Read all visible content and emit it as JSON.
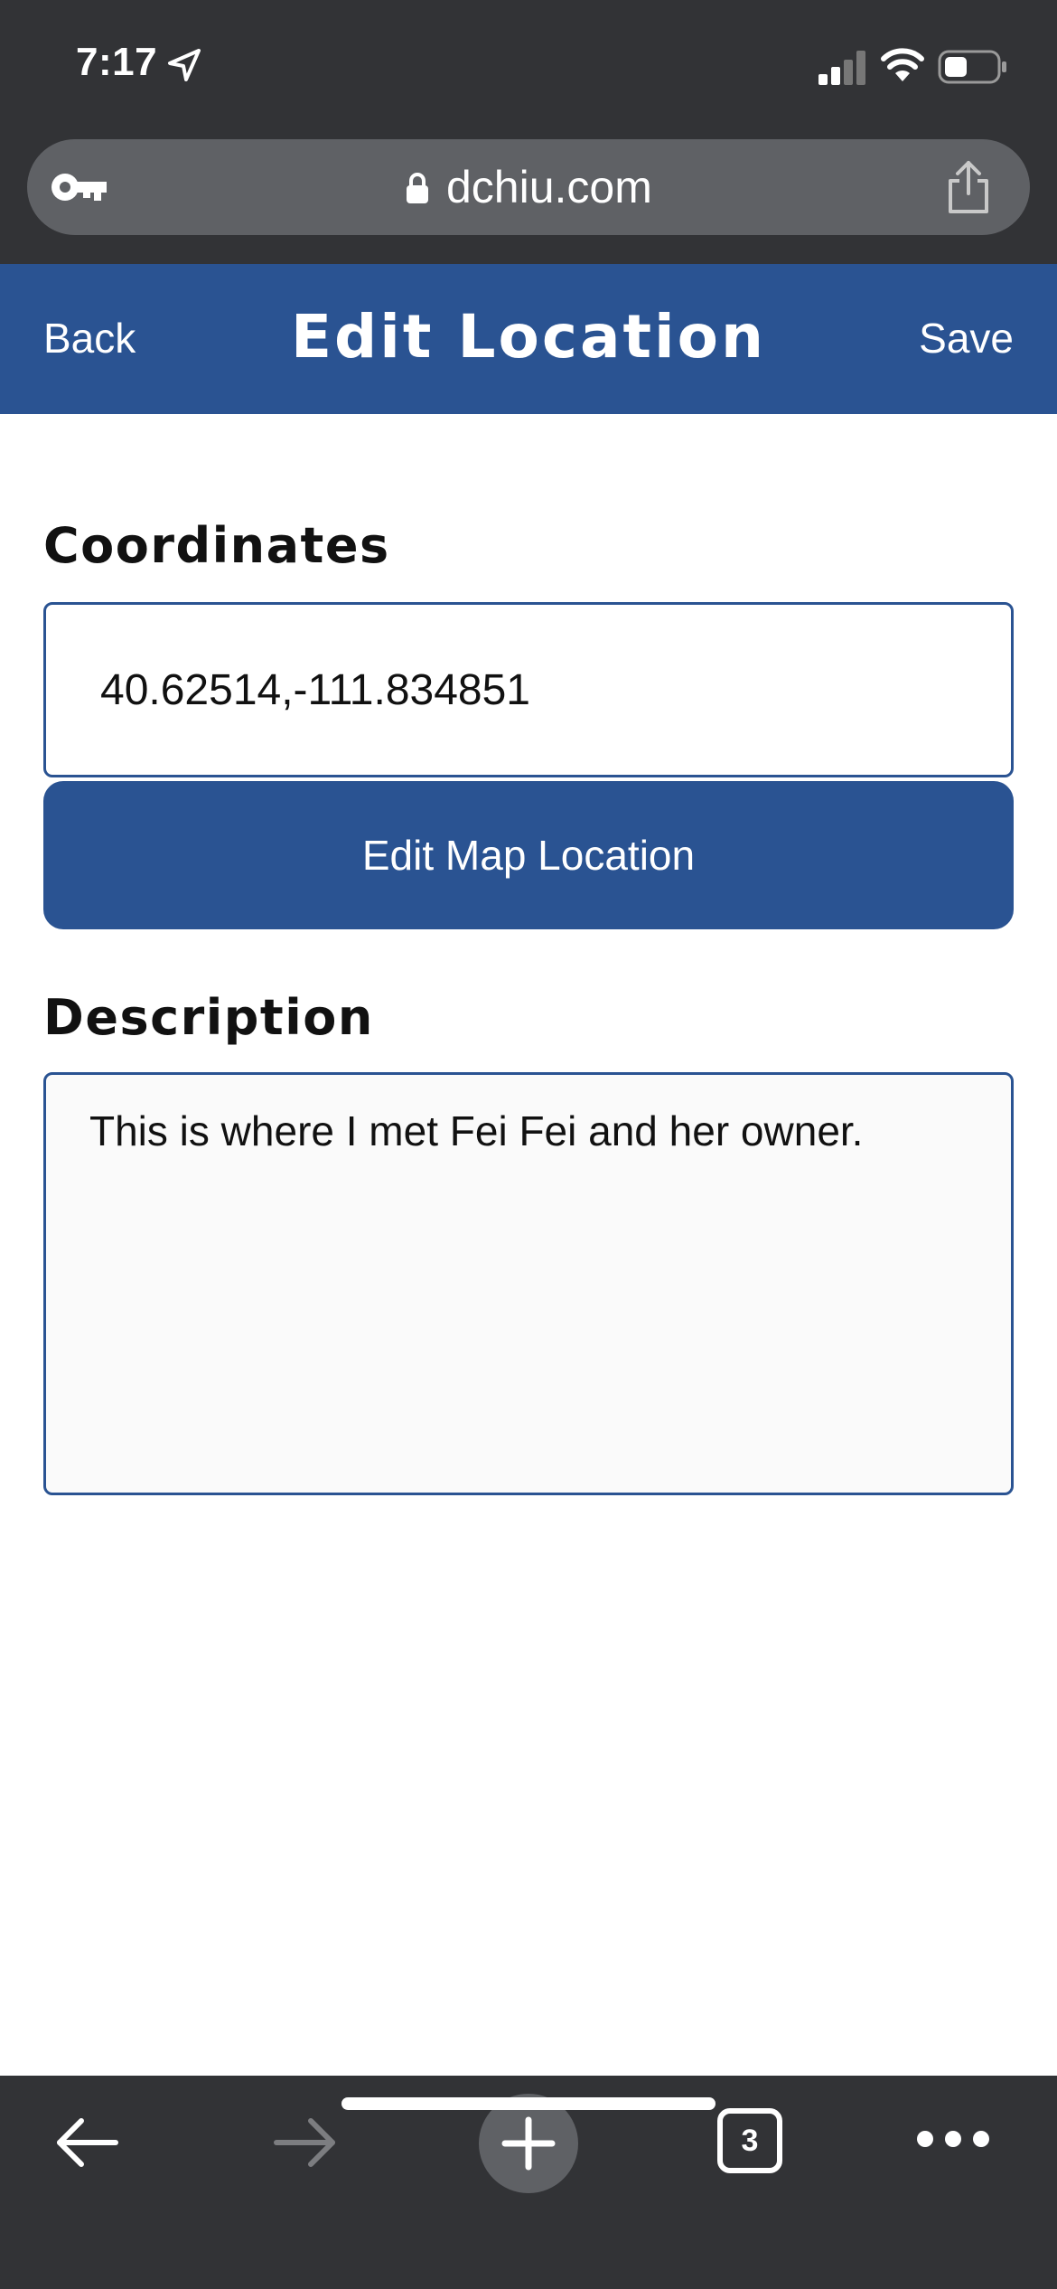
{
  "status_bar": {
    "time": "7:17",
    "icons": [
      "location-arrow-icon",
      "cellular-signal-icon",
      "wifi-icon",
      "battery-icon"
    ]
  },
  "browser": {
    "url": "dchiu.com",
    "icons": [
      "key-icon",
      "lock-icon",
      "share-icon"
    ],
    "toolbar": {
      "open_tabs_count": "3",
      "icons": [
        "back-arrow-icon",
        "forward-arrow-icon",
        "new-tab-plus-icon",
        "tabs-icon",
        "more-icon"
      ]
    }
  },
  "header": {
    "back_label": "Back",
    "title": "Edit Location",
    "save_label": "Save"
  },
  "form": {
    "coordinates_label": "Coordinates",
    "coordinates_value": "40.62514,-111.834851",
    "edit_map_button_label": "Edit Map Location",
    "description_label": "Description",
    "description_value": "This is where I met Fei Fei and her owner."
  },
  "colors": {
    "header_bg": "#2a5392",
    "chrome_bg": "#323336",
    "address_bar_bg": "#5f6165"
  }
}
